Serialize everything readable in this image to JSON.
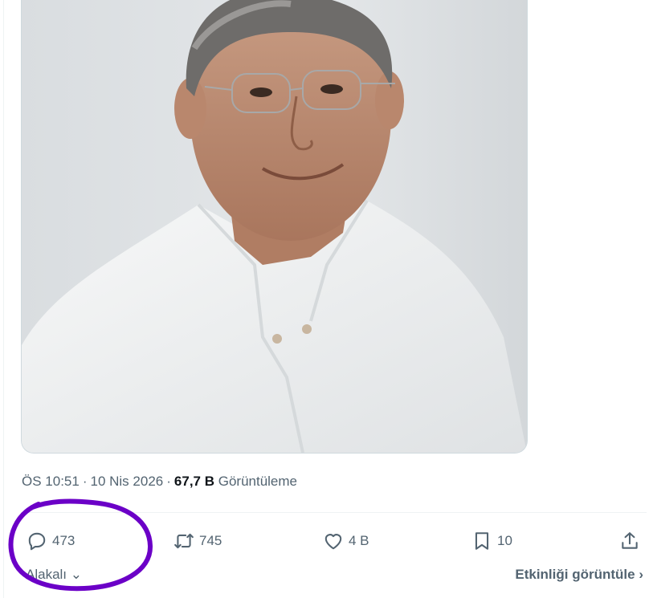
{
  "tweet": {
    "image": {
      "description": "portrait"
    },
    "meta": {
      "time": "ÖS 10:51",
      "separator": "·",
      "date": "10 Nis 2026",
      "views_count": "67,7 B",
      "views_label": "Görüntüleme"
    },
    "actions": {
      "reply": {
        "icon": "reply-icon",
        "count": "473"
      },
      "retweet": {
        "icon": "retweet-icon",
        "count": "745"
      },
      "like": {
        "icon": "heart-icon",
        "count": "4 B"
      },
      "bookmark": {
        "icon": "bookmark-icon",
        "count": "10"
      },
      "share": {
        "icon": "share-icon"
      }
    },
    "footer": {
      "sort_label": "Alakalı",
      "engagement_link": "Etkinliği görüntüle"
    }
  },
  "annotation": {
    "color": "#6b00c7",
    "shape": "hand-drawn circle"
  }
}
